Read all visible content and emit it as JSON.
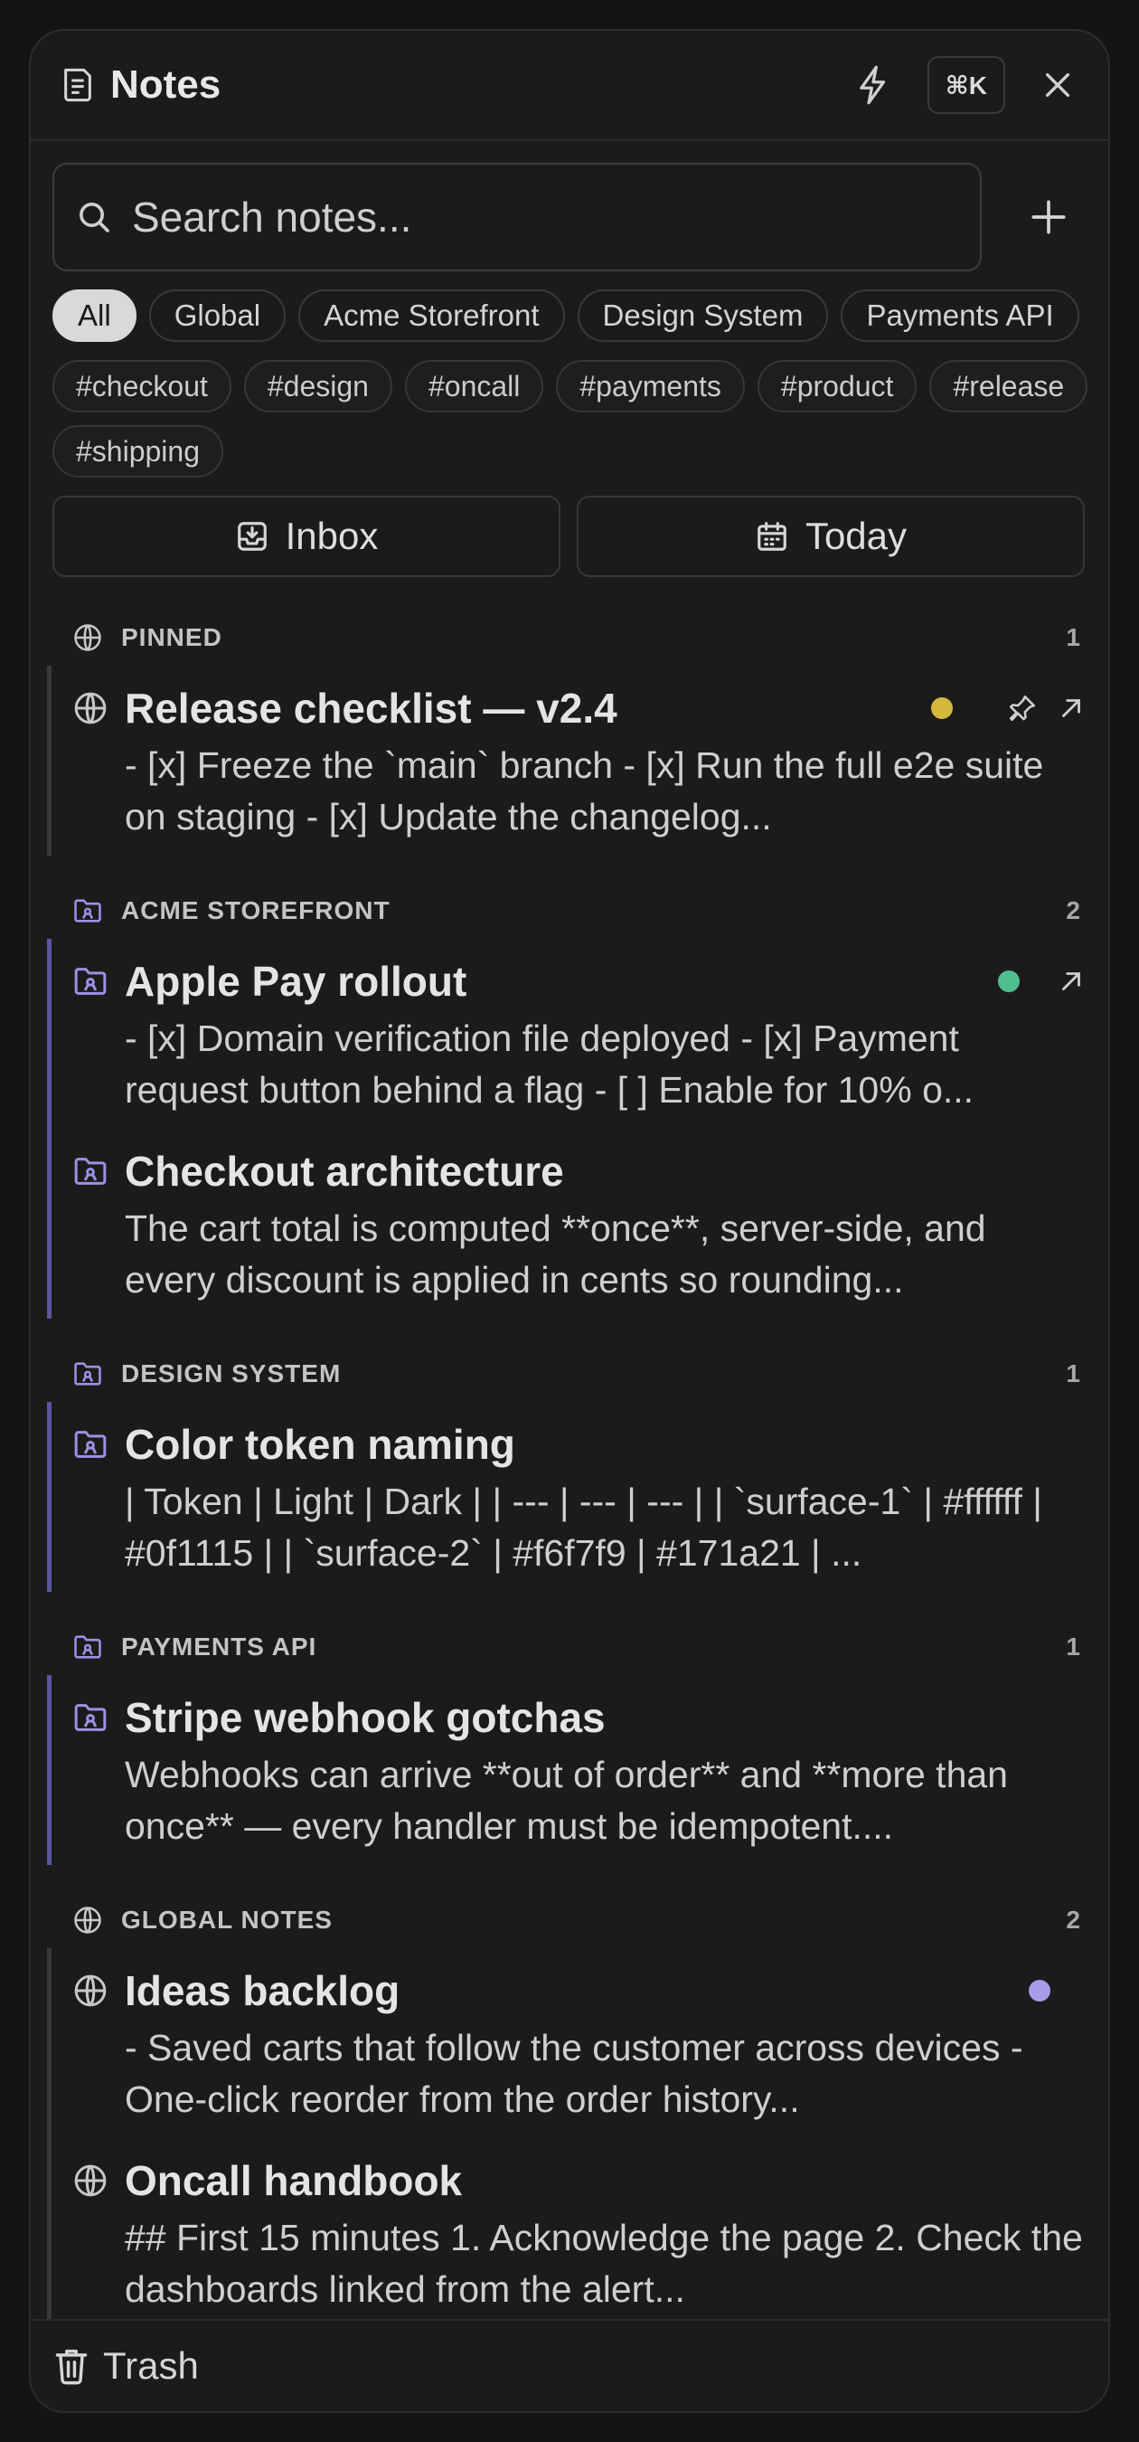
{
  "app": {
    "title": "Notes",
    "shortcut": "⌘K"
  },
  "search": {
    "placeholder": "Search notes...",
    "value": ""
  },
  "scopes": [
    {
      "label": "All",
      "active": true
    },
    {
      "label": "Global"
    },
    {
      "label": "Acme Storefront"
    },
    {
      "label": "Design System"
    },
    {
      "label": "Payments API"
    }
  ],
  "tags": [
    "#checkout",
    "#design",
    "#oncall",
    "#payments",
    "#product",
    "#release",
    "#shipping"
  ],
  "views": {
    "inbox": "Inbox",
    "today": "Today"
  },
  "sections": [
    {
      "name": "PINNED",
      "count": "1",
      "icon": "globe-icon",
      "notes": [
        {
          "title": "Release checklist — v2.4",
          "icon": "globe-icon",
          "dot_color": "#d4b73c",
          "body": "- [x] Freeze the `main` branch - [x] Run the full e2e suite on staging - [x] Update the changelog..."
        }
      ]
    },
    {
      "name": "ACME STOREFRONT",
      "count": "2",
      "icon": "project-folder-icon",
      "notes": [
        {
          "title": "Apple Pay rollout",
          "icon": "project-folder-icon",
          "dot_color": "#4fc08d",
          "body": "- [x] Domain verification file deployed - [x] Payment request button behind a flag - [ ] Enable for 10% o..."
        },
        {
          "title": "Checkout architecture",
          "icon": "project-folder-icon",
          "body": "The cart total is computed **once**, server-side, and every discount is applied in cents so rounding..."
        }
      ]
    },
    {
      "name": "DESIGN SYSTEM",
      "count": "1",
      "icon": "project-folder-icon",
      "notes": [
        {
          "title": "Color token naming",
          "icon": "project-folder-icon",
          "body": "| Token | Light | Dark | | --- | --- | --- | | `surface-1` | #ffffff | #0f1115 | | `surface-2` | #f6f7f9 | #171a21 | ..."
        }
      ]
    },
    {
      "name": "PAYMENTS API",
      "count": "1",
      "icon": "project-folder-icon",
      "notes": [
        {
          "title": "Stripe webhook gotchas",
          "icon": "project-folder-icon",
          "body": "Webhooks can arrive **out of order** and **more than once** — every handler must be idempotent...."
        }
      ]
    },
    {
      "name": "GLOBAL NOTES",
      "count": "2",
      "icon": "globe-icon",
      "notes": [
        {
          "title": "Ideas backlog",
          "icon": "globe-icon",
          "dot_color": "#a99bea",
          "body": "- Saved carts that follow the customer across devices - One-click reorder from the order history..."
        },
        {
          "title": "Oncall handbook",
          "icon": "globe-icon",
          "body": "## First 15 minutes 1. Acknowledge the page 2. Check the dashboards linked from the alert..."
        }
      ]
    }
  ],
  "footer": {
    "trash": "Trash"
  },
  "colors": {
    "accent_project": "#5b55a3",
    "background": "#1b1b1b"
  }
}
